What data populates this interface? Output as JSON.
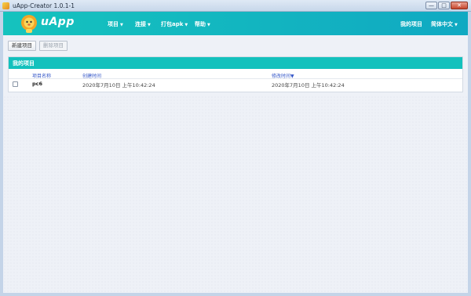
{
  "window": {
    "title": "uApp-Creator 1.0.1-1",
    "buttons": {
      "minimize": "—",
      "maximize": "□",
      "close": "✕"
    }
  },
  "header": {
    "logo_text": "uApp",
    "nav": [
      {
        "label": "项目",
        "has_caret": true
      },
      {
        "label": "连接",
        "has_caret": true
      },
      {
        "label": "打包apk",
        "has_caret": true
      },
      {
        "label": "帮助",
        "has_caret": true
      }
    ],
    "right": {
      "my_projects": "我的项目",
      "language": "简体中文"
    },
    "caret": "▼"
  },
  "toolbar": {
    "new_project": "新建项目",
    "delete_project": "删除项目"
  },
  "panel": {
    "title": "我的项目",
    "columns": {
      "name": "项目名称",
      "created": "创建时间",
      "modified": "修改时间▼"
    },
    "rows": [
      {
        "name": "pc6",
        "created": "2020年7月10日 上午10:42:24",
        "modified": "2020年7月10日 上午10:42:24",
        "checked": false
      }
    ]
  },
  "colors": {
    "header_start": "#15c3be",
    "header_end": "#10a9c2",
    "panel_header": "#13c1bd",
    "column_header_text": "#3557c8"
  },
  "icons": [
    "app-icon",
    "lion-mascot-logo",
    "checkbox"
  ]
}
